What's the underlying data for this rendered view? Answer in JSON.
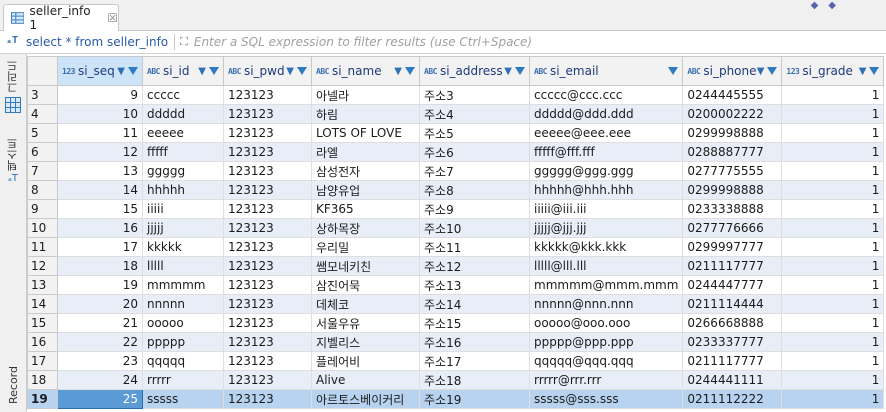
{
  "tab": {
    "label": "seller_info 1",
    "close": "☒"
  },
  "filter": {
    "query": "select * from seller_info",
    "placeholder": "Enter a SQL expression to filter results (use Ctrl+Space)"
  },
  "sidebar": {
    "grid_label": "그리드",
    "text_label": "텍스트",
    "record_label": "Record"
  },
  "columns": [
    {
      "name": "si_seq",
      "type": "123"
    },
    {
      "name": "si_id",
      "type": "ABC"
    },
    {
      "name": "si_pwd",
      "type": "ABC"
    },
    {
      "name": "si_name",
      "type": "ABC"
    },
    {
      "name": "si_address",
      "type": "ABC"
    },
    {
      "name": "si_email",
      "type": "ABC"
    },
    {
      "name": "si_phone",
      "type": "ABC"
    },
    {
      "name": "si_grade",
      "type": "123"
    }
  ],
  "rows": [
    {
      "n": "3",
      "cells": [
        "9",
        "ccccc",
        "123123",
        "아넬라",
        "주소3",
        "ccccc@ccc.ccc",
        "0244445555",
        "1"
      ]
    },
    {
      "n": "4",
      "cells": [
        "10",
        "ddddd",
        "123123",
        "하림",
        "주소4",
        "ddddd@ddd.ddd",
        "0200002222",
        "1"
      ]
    },
    {
      "n": "5",
      "cells": [
        "11",
        "eeeee",
        "123123",
        "LOTS OF LOVE",
        "주소5",
        "eeeee@eee.eee",
        "0299998888",
        "1"
      ]
    },
    {
      "n": "6",
      "cells": [
        "12",
        "fffff",
        "123123",
        "라엘",
        "주소6",
        "fffff@fff.fff",
        "0288887777",
        "1"
      ]
    },
    {
      "n": "7",
      "cells": [
        "13",
        "ggggg",
        "123123",
        "삼성전자",
        "주소7",
        "ggggg@ggg.ggg",
        "0277775555",
        "1"
      ]
    },
    {
      "n": "8",
      "cells": [
        "14",
        "hhhhh",
        "123123",
        "남양유업",
        "주소8",
        "hhhhh@hhh.hhh",
        "0299998888",
        "1"
      ]
    },
    {
      "n": "9",
      "cells": [
        "15",
        "iiiii",
        "123123",
        "KF365",
        "주소9",
        "iiiii@iii.iii",
        "0233338888",
        "1"
      ]
    },
    {
      "n": "10",
      "cells": [
        "16",
        "jjjjj",
        "123123",
        "상하목장",
        "주소10",
        "jjjjj@jjj.jjj",
        "0277776666",
        "1"
      ]
    },
    {
      "n": "11",
      "cells": [
        "17",
        "kkkkk",
        "123123",
        "우리밀",
        "주소11",
        "kkkkk@kkk.kkk",
        "0299997777",
        "1"
      ]
    },
    {
      "n": "12",
      "cells": [
        "18",
        "lllll",
        "123123",
        "쌤모네키친",
        "주소12",
        "lllll@lll.lll",
        "0211117777",
        "1"
      ]
    },
    {
      "n": "13",
      "cells": [
        "19",
        "mmmmm",
        "123123",
        "삼진어묵",
        "주소13",
        "mmmmm@mmm.mmm",
        "0244447777",
        "1"
      ]
    },
    {
      "n": "14",
      "cells": [
        "20",
        "nnnnn",
        "123123",
        "데체코",
        "주소14",
        "nnnnn@nnn.nnn",
        "0211114444",
        "1"
      ]
    },
    {
      "n": "15",
      "cells": [
        "21",
        "ooooo",
        "123123",
        "서울우유",
        "주소15",
        "ooooo@ooo.ooo",
        "0266668888",
        "1"
      ]
    },
    {
      "n": "16",
      "cells": [
        "22",
        "ppppp",
        "123123",
        "지벨리스",
        "주소16",
        "ppppp@ppp.ppp",
        "0233337777",
        "1"
      ]
    },
    {
      "n": "17",
      "cells": [
        "23",
        "qqqqq",
        "123123",
        "플레어비",
        "주소17",
        "qqqqq@qqq.qqq",
        "0211117777",
        "1"
      ]
    },
    {
      "n": "18",
      "cells": [
        "24",
        "rrrrr",
        "123123",
        "Alive",
        "주소18",
        "rrrrr@rrr.rrr",
        "0244441111",
        "1"
      ]
    },
    {
      "n": "19",
      "cells": [
        "25",
        "sssss",
        "123123",
        "아르토스베이커리",
        "주소19",
        "sssss@sss.sss",
        "0211112222",
        "1"
      ]
    }
  ],
  "selected_row": "19"
}
